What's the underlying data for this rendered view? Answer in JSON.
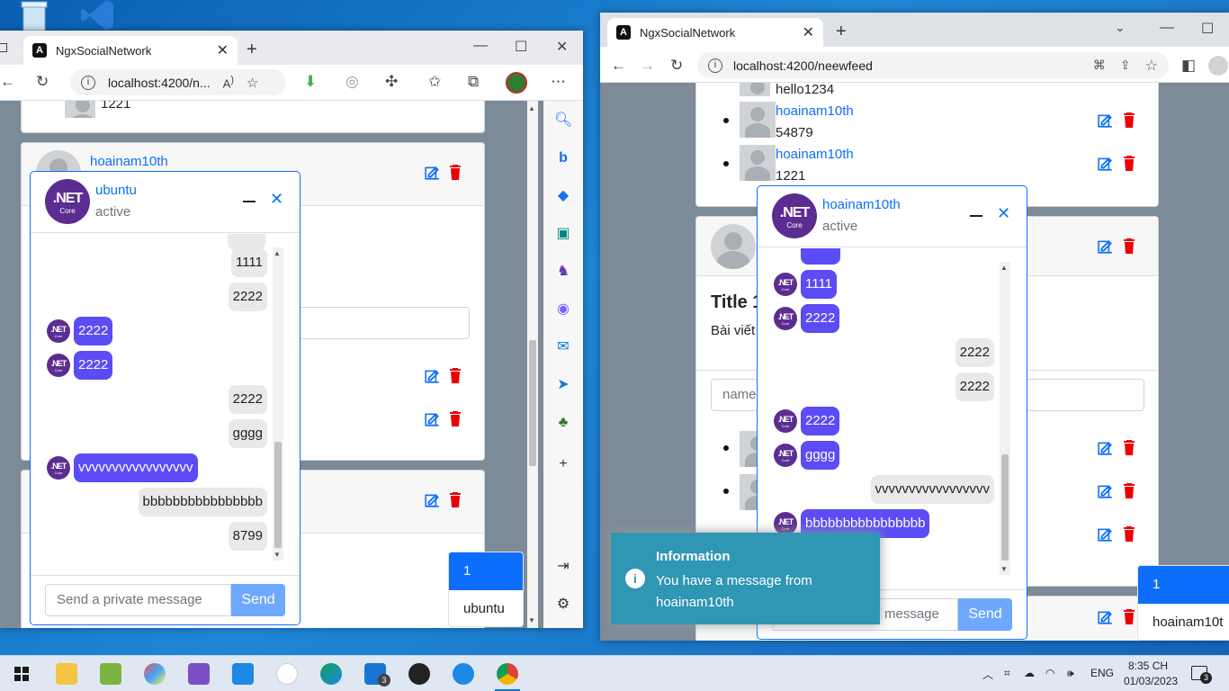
{
  "left_browser": {
    "tab_title": "NgxSocialNetwork",
    "url": "localhost:4200/n...",
    "feed": {
      "partial_text": "1221",
      "post_author": "hoainam10th"
    },
    "chat": {
      "name": "ubuntu",
      "status": "active",
      "messages": [
        {
          "side": "out",
          "text": "1111"
        },
        {
          "side": "out",
          "text": "2222"
        },
        {
          "side": "in",
          "text": "2222"
        },
        {
          "side": "in",
          "text": "2222"
        },
        {
          "side": "out",
          "text": "2222"
        },
        {
          "side": "out",
          "text": "gggg"
        },
        {
          "side": "in",
          "text": "vvvvvvvvvvvvvvvvv"
        },
        {
          "side": "out",
          "text": "bbbbbbbbbbbbbbbb"
        },
        {
          "side": "out",
          "text": "8799"
        }
      ],
      "input_placeholder": "Send a private message",
      "send_label": "Send"
    },
    "online_users": {
      "count": "1",
      "user": "ubuntu"
    }
  },
  "right_browser": {
    "tab_title": "NgxSocialNetwork",
    "url": "localhost:4200/neewfeed",
    "feed": {
      "comments": [
        {
          "user": "",
          "text": "hello1234"
        },
        {
          "user": "hoainam10th",
          "text": "54879"
        },
        {
          "user": "hoainam10th",
          "text": "1221"
        }
      ],
      "post_title": "Title 1",
      "post_body": "Bài viết",
      "name_placeholder": "name"
    },
    "chat": {
      "name": "hoainam10th",
      "status": "active",
      "messages": [
        {
          "side": "in",
          "text": "1111"
        },
        {
          "side": "in",
          "text": "2222"
        },
        {
          "side": "out",
          "text": "2222"
        },
        {
          "side": "out",
          "text": "2222"
        },
        {
          "side": "in",
          "text": "2222"
        },
        {
          "side": "in",
          "text": "gggg"
        },
        {
          "side": "out",
          "text": "vvvvvvvvvvvvvvvvv"
        },
        {
          "side": "in",
          "text": "bbbbbbbbbbbbbbbb"
        }
      ],
      "input_placeholder": "message",
      "send_label": "Send"
    },
    "online_users": {
      "count": "1",
      "user": "hoainam10t"
    }
  },
  "toast": {
    "title": "Information",
    "message": "You have a message from hoainam10th"
  },
  "logo": {
    "line1": ".NET",
    "line2": "Core"
  },
  "taskbar": {
    "lang": "ENG",
    "time": "8:35 CH",
    "date": "01/03/2023",
    "mail_badge": "3",
    "notif_badge": "3"
  },
  "colors": {
    "accent": "#0d6efd",
    "bubble_in": "#5b4cf5",
    "bubble_out": "#e9e9e9",
    "net_purple": "#5c2d91",
    "toast": "#2f96b4",
    "delete": "#dc3545"
  }
}
